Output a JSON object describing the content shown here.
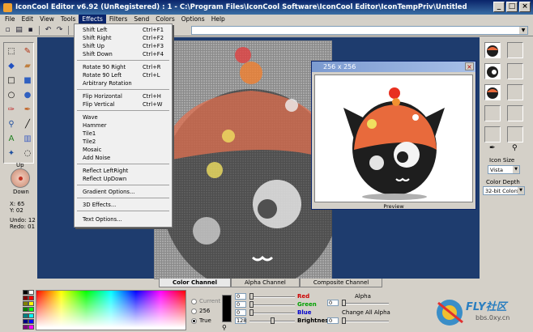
{
  "window": {
    "title": "IconCool Editor v6.92 (UnRegistered) : 1 - C:\\Program Files\\IconCool Software\\IconCool Editor\\IconTempPriv\\Untitled"
  },
  "menubar": [
    "File",
    "Edit",
    "View",
    "Tools",
    "Effects",
    "Filters",
    "Send",
    "Colors",
    "Options",
    "Help"
  ],
  "effects_menu": {
    "items": [
      {
        "label": "Shift Left",
        "shortcut": "Ctrl+F1"
      },
      {
        "label": "Shift Right",
        "shortcut": "Ctrl+F2"
      },
      {
        "label": "Shift Up",
        "shortcut": "Ctrl+F3"
      },
      {
        "label": "Shift Down",
        "shortcut": "Ctrl+F4"
      },
      {
        "label": "Rotate 90 Right",
        "shortcut": "Ctrl+R"
      },
      {
        "label": "Rotate 90 Left",
        "shortcut": "Ctrl+L"
      },
      {
        "label": "Arbitrary Rotation",
        "shortcut": ""
      },
      {
        "label": "Flip Horizontal",
        "shortcut": "Ctrl+H"
      },
      {
        "label": "Flip Vertical",
        "shortcut": "Ctrl+W"
      },
      {
        "label": "Wave",
        "shortcut": ""
      },
      {
        "label": "Hammer",
        "shortcut": ""
      },
      {
        "label": "Tile1",
        "shortcut": ""
      },
      {
        "label": "Tile2",
        "shortcut": ""
      },
      {
        "label": "Mosaic",
        "shortcut": ""
      },
      {
        "label": "Add Noise",
        "shortcut": ""
      },
      {
        "label": "Reflect LeftRight",
        "shortcut": ""
      },
      {
        "label": "Reflect UpDown",
        "shortcut": ""
      },
      {
        "label": "Gradient Options...",
        "shortcut": ""
      },
      {
        "label": "3D Effects...",
        "shortcut": ""
      },
      {
        "label": "Text Options...",
        "shortcut": ""
      }
    ]
  },
  "left_panel": {
    "up_label": "Up",
    "down_label": "Down",
    "x": "X: 65",
    "y": "Y: 02",
    "undo": "Undo: 12",
    "redo": "Redo: 01"
  },
  "preview": {
    "title": "256 x 256",
    "caption": "Preview"
  },
  "right_panel": {
    "icon_size_label": "Icon Size",
    "icon_size_value": "Vista",
    "color_depth_label": "Color Depth",
    "color_depth_value": "32-bit Colors"
  },
  "channel_tabs": [
    "Color Channel",
    "Alpha Channel",
    "Composite Channel"
  ],
  "color_mode": {
    "options": [
      "Current",
      "256",
      "True"
    ],
    "selected": "True"
  },
  "color_values": {
    "red_label": "Red",
    "green_label": "Green",
    "blue_label": "Blue",
    "brightness_label": "Brightness",
    "box1": "0",
    "box2": "0",
    "box3": "0",
    "box4": "128"
  },
  "alpha": {
    "alpha_label": "Alpha",
    "alpha_value": "0",
    "change_all_label": "Change All Alpha",
    "change_all_value": "0"
  },
  "logo": {
    "brand": "FLY社区",
    "url": "bbs.0xy.cn"
  },
  "colors": {
    "title_start": "#0a246a",
    "canvas_bg": "#1e3c6e",
    "red_label": "#cc0000",
    "green_label": "#00a000",
    "blue_label": "#0000cc"
  }
}
